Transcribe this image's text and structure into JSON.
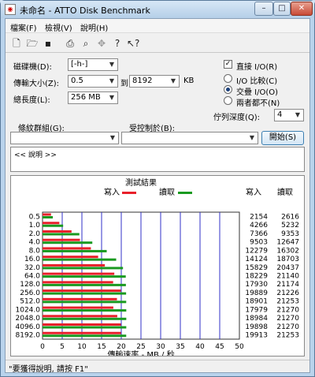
{
  "window": {
    "title": "未命名 - ATTO Disk Benchmark",
    "min_glyph": "–",
    "max_glyph": "□",
    "close_glyph": "✕"
  },
  "menu": [
    "檔案(F)",
    "檢視(V)",
    "說明(H)"
  ],
  "settings": {
    "drive_label": "磁碟機(D):",
    "drive_value": "[-h-]",
    "transfer_label": "傳輸大小(Z):",
    "transfer_from": "0.5",
    "to_label": "到",
    "transfer_to": "8192",
    "transfer_unit": "KB",
    "total_length_label": "總長度(L):",
    "total_length_value": "256 MB",
    "direct_io_label": "直接 I/O(R)",
    "io_compare_label": "I/O 比較(C)",
    "overlapped_io_label": "交疊 I/O(O)",
    "neither_label": "兩者都不(N)",
    "queue_depth_label": "佇列深度(Q):",
    "queue_depth_value": "4",
    "controlled_by_label": "受控制於(B):",
    "stripe_group_label": "條紋群組(G):",
    "start_button": "開始(S)"
  },
  "description": "<< 說明 >>",
  "status_bar": "\"要獲得說明, 請按 F1\"",
  "colors": {
    "write": "#e8202a",
    "read": "#1a9a20",
    "grid": "#3030c8"
  },
  "chart_data": {
    "type": "bar",
    "orientation": "horizontal",
    "title": "測試結果",
    "xlabel": "傳輸速率 - MB / 秒",
    "xlim": [
      0,
      50
    ],
    "xticks": [
      0,
      5,
      10,
      15,
      20,
      25,
      30,
      35,
      40,
      45,
      50
    ],
    "categories": [
      "0.5",
      "1.0",
      "2.0",
      "4.0",
      "8.0",
      "16.0",
      "32.0",
      "64.0",
      "128.0",
      "256.0",
      "512.0",
      "1024.0",
      "2048.0",
      "4096.0",
      "8192.0"
    ],
    "write_header": "寫入",
    "read_header": "讀取",
    "series": [
      {
        "name": "寫入",
        "values": [
          2.154,
          4.266,
          7.366,
          9.503,
          12.279,
          14.124,
          15.829,
          18.229,
          17.93,
          19.889,
          18.901,
          17.979,
          18.984,
          19.898,
          19.913
        ],
        "labels": [
          "2154",
          "4266",
          "7366",
          "9503",
          "12279",
          "14124",
          "15829",
          "18229",
          "17930",
          "19889",
          "18901",
          "17979",
          "18984",
          "19898",
          "19913"
        ]
      },
      {
        "name": "讀取",
        "values": [
          2.616,
          5.232,
          9.353,
          12.647,
          16.302,
          18.703,
          20.437,
          21.14,
          21.174,
          21.226,
          21.253,
          21.27,
          21.27,
          21.27,
          21.253
        ],
        "labels": [
          "2616",
          "5232",
          "9353",
          "12647",
          "16302",
          "18703",
          "20437",
          "21140",
          "21174",
          "21226",
          "21253",
          "21270",
          "21270",
          "21270",
          "21253"
        ]
      }
    ]
  }
}
